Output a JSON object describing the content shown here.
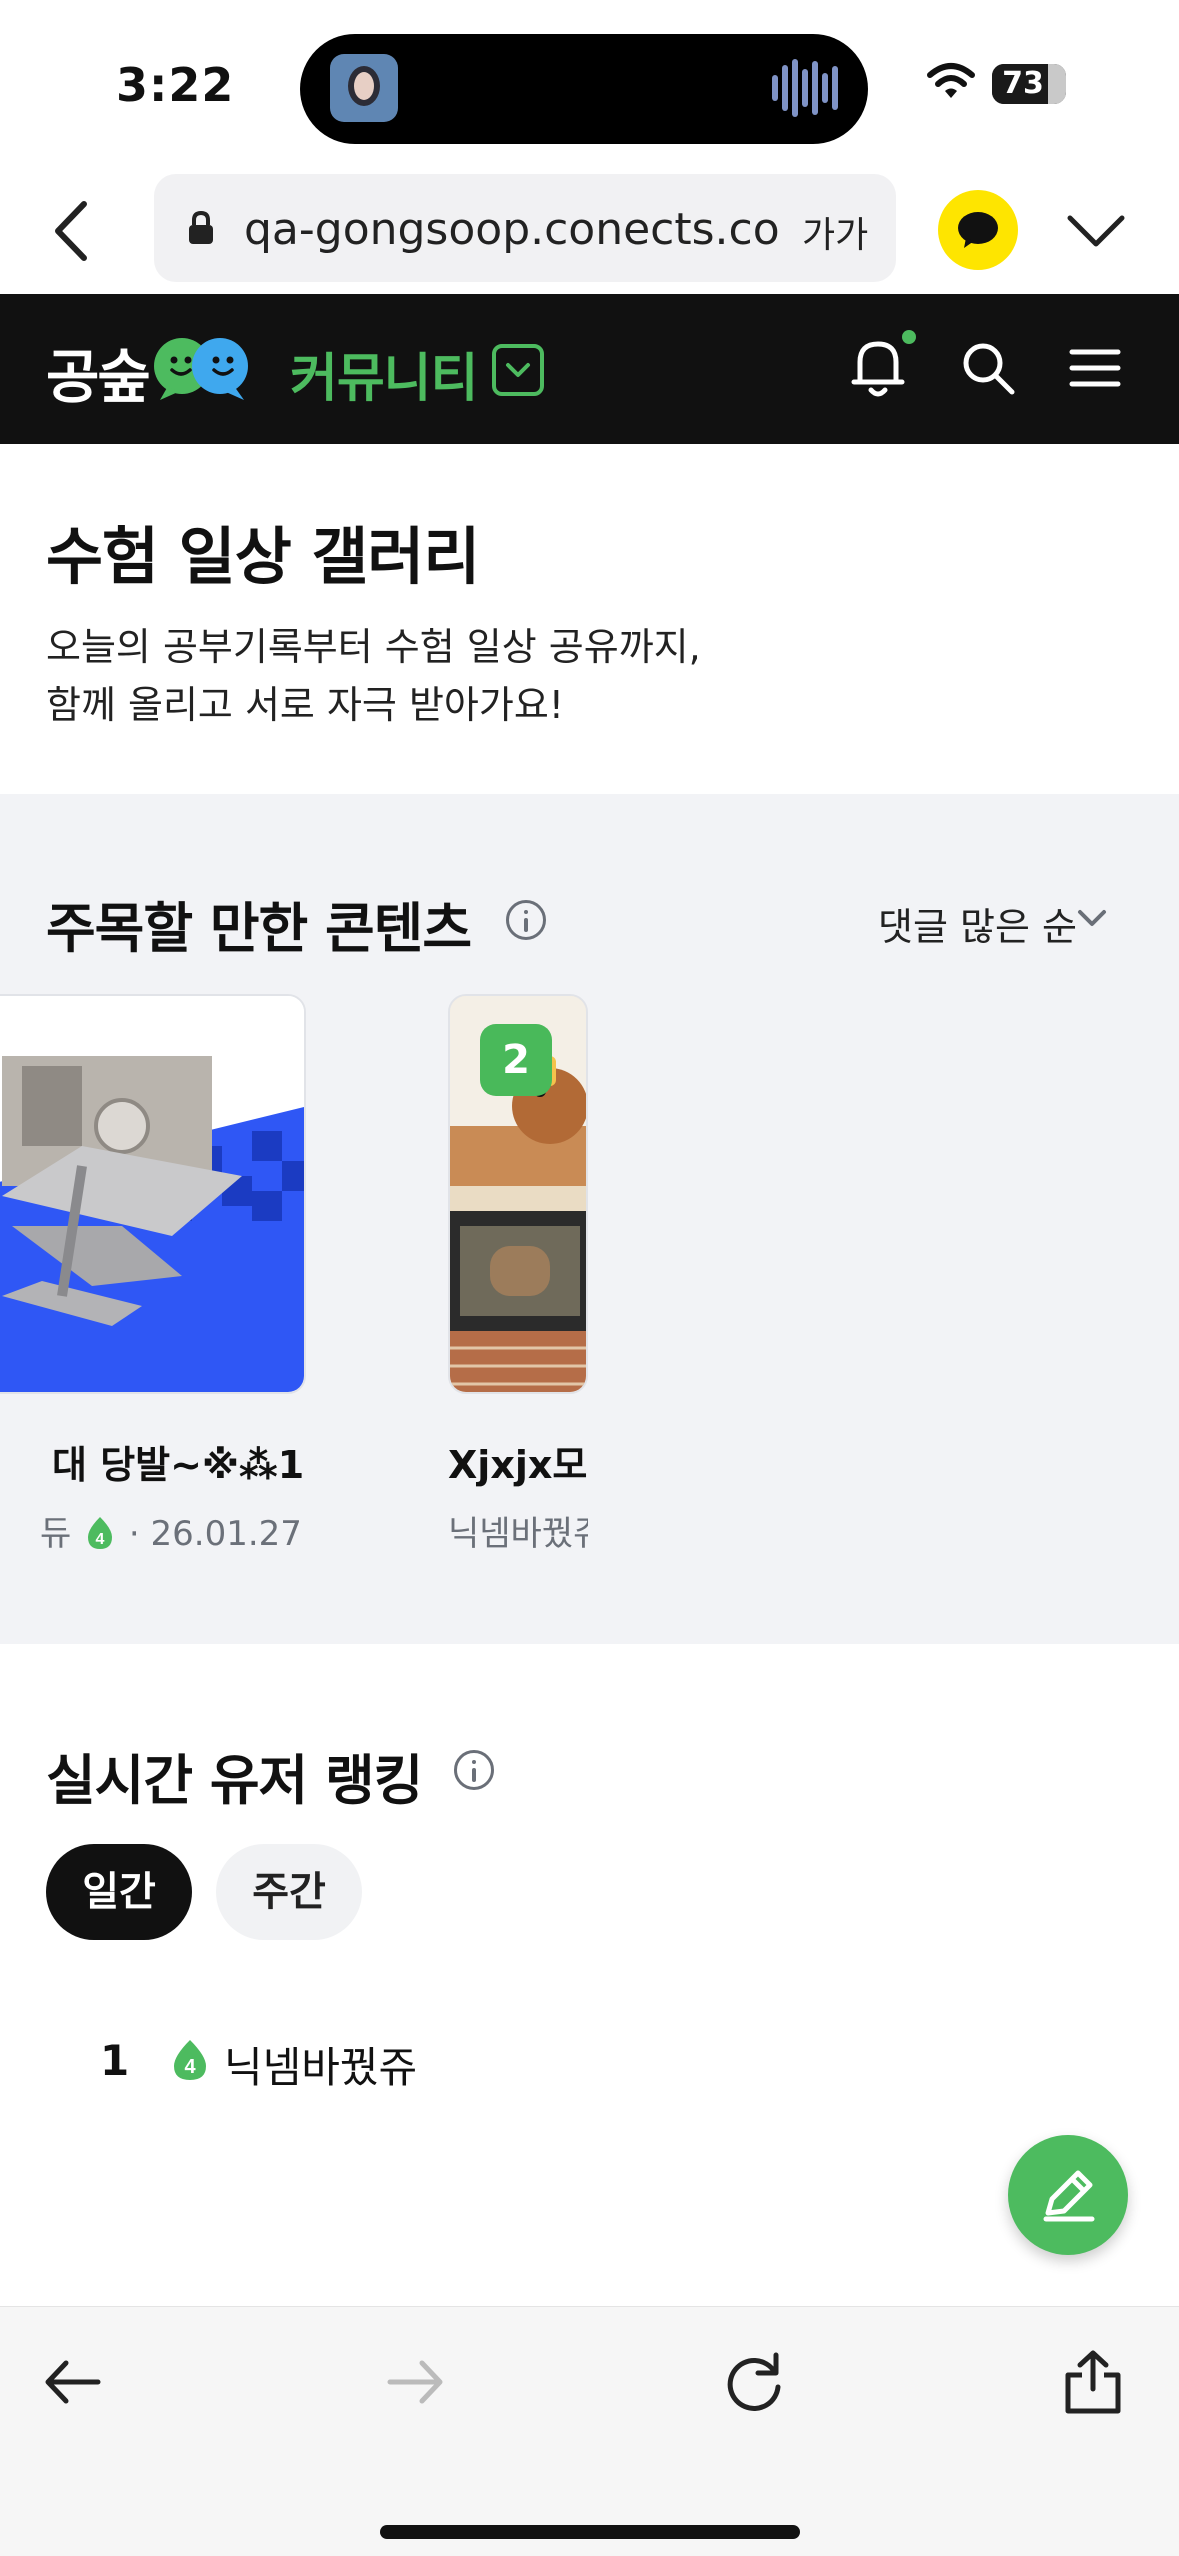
{
  "status_bar": {
    "time": "3:22",
    "battery_percent": "73",
    "battery_level": 0.73
  },
  "browser": {
    "url": "qa-gongsoop.conects.com",
    "text_size_label": "가가"
  },
  "header": {
    "logo": "공숲",
    "section_label": "커뮤니티",
    "notification_dot": true
  },
  "intro": {
    "title": "수험 일상 갤러리",
    "description_line1": "오늘의 공부기록부터 수험 일상 공유까지,",
    "description_line2": "함께 올리고 서로 자극 받아가요!"
  },
  "featured": {
    "title": "주목할 만한 콘텐츠",
    "sort_label": "댓글 많은 순",
    "cards": [
      {
        "title": "대 당발~※⁂1...",
        "author_fragment": "듀",
        "level": "4",
        "date": "26.01.27"
      },
      {
        "rank": "2",
        "title": "Xjxjx모바",
        "author": "닉넴바꿨쥬"
      }
    ]
  },
  "ranking": {
    "title": "실시간 유저 랭킹",
    "tabs": [
      {
        "label": "일간",
        "active": true
      },
      {
        "label": "주간",
        "active": false
      }
    ],
    "rows": [
      {
        "rank": "1",
        "level": "4",
        "name": "닉넴바꿨쥬"
      }
    ]
  },
  "colors": {
    "brand_green": "#4dbb5f",
    "header_bg": "#111111",
    "featured_bg": "#f2f3f6",
    "kakao_yellow": "#fee500"
  },
  "icons": [
    "back-chevron-icon",
    "lock-icon",
    "kakao-talk-icon",
    "chevron-down-icon",
    "bell-icon",
    "search-icon",
    "menu-icon",
    "info-icon",
    "pencil-icon",
    "arrow-left-icon",
    "arrow-right-icon",
    "refresh-icon",
    "share-icon"
  ]
}
